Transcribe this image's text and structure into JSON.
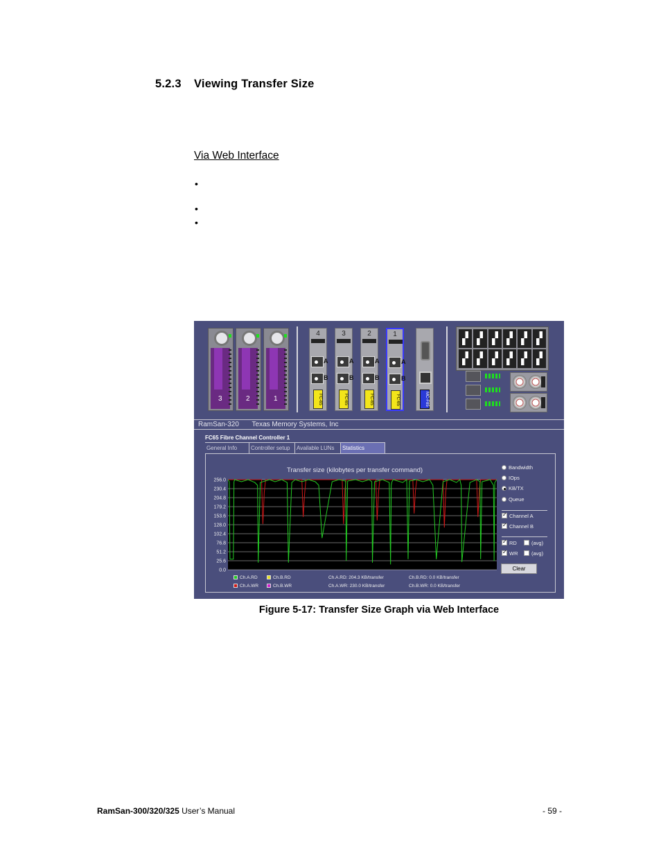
{
  "section": {
    "number": "5.2.3",
    "title": "Viewing Transfer Size"
  },
  "subheading": "Via Web Interface",
  "bullets": [
    "•",
    "•",
    "•"
  ],
  "figure": {
    "drives": [
      "3",
      "2",
      "1"
    ],
    "cards": [
      {
        "number": "4",
        "label": "FC-65",
        "port_a": "A",
        "port_b": "B"
      },
      {
        "number": "3",
        "label": "FC-65",
        "port_a": "A",
        "port_b": "B"
      },
      {
        "number": "2",
        "label": "FC-65",
        "port_a": "A",
        "port_b": "B"
      },
      {
        "number": "1",
        "label": "FC-65",
        "port_a": "A",
        "port_b": "B"
      }
    ],
    "mgmt_card_label": "MC-F85",
    "app_bar": {
      "product": "RamSan-320",
      "company": "Texas Memory Systems, Inc"
    },
    "controller_title": "FC65 Fibre Channel Controller 1",
    "tabs": [
      "General Info",
      "Controller setup",
      "Available LUNs",
      "Statistics"
    ],
    "active_tab": "Statistics",
    "options": {
      "radios": [
        {
          "label": "Bandwidth",
          "selected": false
        },
        {
          "label": "IOps",
          "selected": false
        },
        {
          "label": "KB/TX",
          "selected": true
        },
        {
          "label": "Queue",
          "selected": false
        }
      ],
      "channels": [
        {
          "label": "Channel A",
          "checked": true
        },
        {
          "label": "Channel B",
          "checked": true
        }
      ],
      "rd": {
        "label": "RD",
        "checked": true,
        "avg_label": "(avg)",
        "avg_checked": false
      },
      "wr": {
        "label": "WR",
        "checked": true,
        "avg_label": "(avg)",
        "avg_checked": false
      },
      "clear_label": "Clear"
    },
    "legend": [
      {
        "label": "Ch.A.RD",
        "color": "#22cc22"
      },
      {
        "label": "Ch.B.RD",
        "color": "#e8e020"
      },
      {
        "label": "Ch.A.WR",
        "color": "#d01818"
      },
      {
        "label": "Ch.B.WR",
        "color": "#d020d0"
      }
    ],
    "stats": {
      "a_rd": "Ch.A.RD:  204.3 KB/transfer",
      "a_wr": "Ch.A.WR:  230.0 KB/transfer",
      "b_rd": "Ch.B.RD:  0.0 KB/transfer",
      "b_wr": "Ch.B.WR:  0.0 KB/transfer"
    }
  },
  "chart_data": {
    "type": "line",
    "title": "Transfer size (kilobytes per transfer command)",
    "ylim": [
      0,
      256
    ],
    "yticks": [
      "256.0",
      "230.4",
      "204.8",
      "179.2",
      "153.6",
      "128.0",
      "102.4",
      "76.8",
      "51.2",
      "25.6",
      "0.0"
    ],
    "grid": true,
    "series": [
      {
        "name": "Ch.A.RD",
        "color": "#22cc22",
        "x": [
          0,
          2,
          3,
          8,
          9,
          10,
          20,
          30,
          40,
          44,
          45,
          48,
          62,
          70,
          80,
          88,
          90,
          95,
          100,
          110,
          120,
          130,
          135,
          140,
          155,
          165,
          175,
          176,
          178,
          190,
          200,
          210,
          214,
          215,
          218,
          230,
          240,
          242,
          243,
          244,
          246,
          260,
          266,
          268,
          270,
          280,
          290,
          300,
          305,
          310,
          320,
          330,
          340,
          345,
          347,
          348,
          360,
          370,
          375,
          376,
          378,
          390,
          395,
          396,
          397,
          400
        ],
        "values": [
          256,
          250,
          30,
          30,
          250,
          256,
          250,
          256,
          248,
          240,
          20,
          248,
          256,
          250,
          256,
          248,
          20,
          248,
          256,
          250,
          256,
          250,
          240,
          90,
          250,
          256,
          252,
          25,
          252,
          256,
          250,
          256,
          250,
          20,
          250,
          256,
          248,
          15,
          240,
          250,
          256,
          248,
          256,
          30,
          252,
          256,
          250,
          256,
          240,
          30,
          250,
          256,
          248,
          256,
          240,
          22,
          248,
          256,
          250,
          30,
          250,
          256,
          240,
          25,
          248,
          256
        ]
      },
      {
        "name": "Ch.A.WR",
        "color": "#d01818",
        "x": [
          0,
          20,
          40,
          50,
          52,
          54,
          56,
          60,
          80,
          100,
          110,
          112,
          114,
          116,
          120,
          140,
          160,
          170,
          172,
          174,
          176,
          180,
          200,
          215,
          220,
          222,
          224,
          226,
          230,
          250,
          265,
          275,
          277,
          279,
          281,
          285,
          300,
          315,
          320,
          322,
          324,
          326,
          330,
          350,
          365,
          370,
          372,
          374,
          376,
          380,
          400
        ],
        "values": [
          256,
          256,
          256,
          256,
          130,
          220,
          256,
          256,
          256,
          256,
          256,
          150,
          215,
          256,
          256,
          256,
          256,
          256,
          130,
          225,
          256,
          256,
          256,
          256,
          256,
          140,
          220,
          256,
          256,
          256,
          256,
          256,
          160,
          225,
          256,
          256,
          256,
          256,
          256,
          120,
          220,
          256,
          256,
          256,
          256,
          256,
          150,
          225,
          256,
          256,
          256
        ]
      }
    ]
  },
  "caption": "Figure 5-17: Transfer Size Graph via Web Interface",
  "footer": {
    "product": "RamSan-300/320/325",
    "manual": " User’s Manual",
    "page": "- 59 -"
  }
}
